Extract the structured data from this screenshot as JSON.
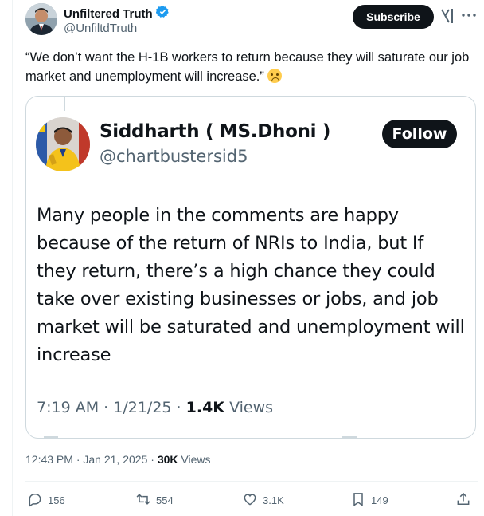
{
  "post": {
    "author_name": "Unfiltered Truth",
    "handle": "@UnfiltdTruth",
    "subscribe_label": "Subscribe",
    "text": "“We don’t want the H-1B workers to return because they will saturate our job market and unemployment will increase.”",
    "emoji": "loudly-crying-face",
    "time": "12:43 PM",
    "separator": "·",
    "date": "Jan 21, 2025",
    "views_count": "30K",
    "views_label": "Views"
  },
  "quoted": {
    "name": "Siddharth ( MS.Dhoni )",
    "handle": "@chartbustersid5",
    "follow_label": "Follow",
    "body": "Many people in the comments are happy because of the return of NRIs to India, but If they return, there’s a high chance they could take over existing businesses or jobs, and job market will be saturated and unemployment will increase",
    "time": "7:19 AM",
    "separator": "·",
    "date": "1/21/25",
    "views_count": "1.4K",
    "views_label": "Views"
  },
  "actions": {
    "replies": "156",
    "reposts": "554",
    "likes": "3.1K",
    "bookmarks": "149"
  },
  "colors": {
    "text_primary": "#0f1419",
    "text_secondary": "#536471",
    "verified_blue": "#1d9bf0",
    "border": "#cfd9de",
    "button_dark": "#0f1419"
  },
  "icons": [
    "verified-badge-icon",
    "grok-icon",
    "more-icon",
    "reply-icon",
    "repost-icon",
    "like-icon",
    "bookmark-icon",
    "share-icon"
  ]
}
